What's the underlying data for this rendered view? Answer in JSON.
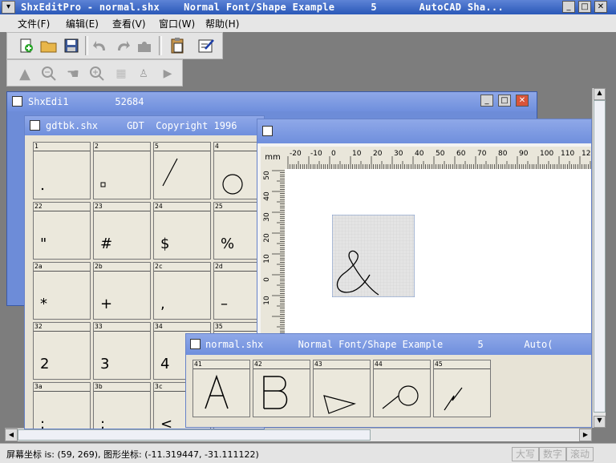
{
  "window": {
    "title": "ShxEditPro - normal.shx    Normal Font/Shape Example      5       AutoCAD Sha..."
  },
  "menu": {
    "items": [
      "文件(F)",
      "编辑(E)",
      "查看(V)",
      "窗口(W)",
      "帮助(H)"
    ]
  },
  "child_window": {
    "title": "ShxEdi1        52684"
  },
  "font_window": {
    "title": "gdtbk.shx     GDT  Copyright 1996",
    "cells": [
      {
        "num": "1",
        "glyph": "dot"
      },
      {
        "num": "2",
        "glyph": "square"
      },
      {
        "num": "5",
        "glyph": "slash"
      },
      {
        "num": "4",
        "glyph": "circle"
      },
      {
        "num": "22",
        "glyph": "text",
        "text": "\""
      },
      {
        "num": "23",
        "glyph": "text",
        "text": "#"
      },
      {
        "num": "24",
        "glyph": "text",
        "text": "$"
      },
      {
        "num": "25",
        "glyph": "text",
        "text": "%"
      },
      {
        "num": "2a",
        "glyph": "text",
        "text": "*"
      },
      {
        "num": "2b",
        "glyph": "text",
        "text": "+"
      },
      {
        "num": "2c",
        "glyph": "text",
        "text": ","
      },
      {
        "num": "2d",
        "glyph": "text",
        "text": "–"
      },
      {
        "num": "32",
        "glyph": "text",
        "text": "2"
      },
      {
        "num": "33",
        "glyph": "text",
        "text": "3"
      },
      {
        "num": "34",
        "glyph": "text",
        "text": "4"
      },
      {
        "num": "35",
        "glyph": "text",
        "text": ""
      },
      {
        "num": "3a",
        "glyph": "text",
        "text": ":"
      },
      {
        "num": "3b",
        "glyph": "text",
        "text": ";"
      },
      {
        "num": "3c",
        "glyph": "text",
        "text": "<"
      },
      {
        "num": "",
        "glyph": "text",
        "text": ""
      }
    ]
  },
  "editor": {
    "unit_label": "mm",
    "h_ticks": [
      "-20",
      "-10",
      "0",
      "10",
      "20",
      "30",
      "40",
      "50",
      "60",
      "70",
      "80",
      "90",
      "100",
      "110",
      "120"
    ],
    "v_ticks": [
      "50",
      "40",
      "30",
      "20",
      "10",
      "0",
      "10"
    ]
  },
  "normal_window": {
    "title": "normal.shx      Normal Font/Shape Example      5       Auto(",
    "cells": [
      {
        "num": "41",
        "glyph": "A"
      },
      {
        "num": "42",
        "glyph": "B"
      },
      {
        "num": "43",
        "glyph": "wedge"
      },
      {
        "num": "44",
        "glyph": "circtail"
      },
      {
        "num": "45",
        "glyph": "bolt"
      }
    ]
  },
  "status": {
    "coords": "屏幕坐标 is: (59, 269), 图形坐标: (-11.319447, -31.111122)",
    "indicators": [
      "大写",
      "数字",
      "滚动"
    ]
  }
}
